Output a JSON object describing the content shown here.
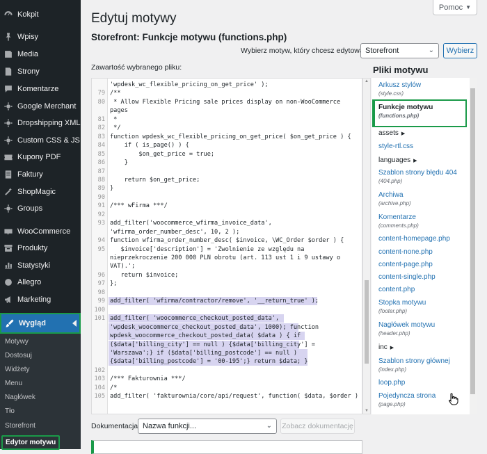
{
  "sidebar": {
    "items": [
      {
        "label": "Kokpit",
        "icon": "dashboard-icon",
        "name": "kokpit"
      },
      {
        "label": "Wpisy",
        "icon": "pushpin-icon",
        "name": "wpisy"
      },
      {
        "label": "Media",
        "icon": "media-icon",
        "name": "media"
      },
      {
        "label": "Strony",
        "icon": "page-icon",
        "name": "strony"
      },
      {
        "label": "Komentarze",
        "icon": "comment-icon",
        "name": "komentarze"
      },
      {
        "label": "Google Merchant",
        "icon": "gear-icon",
        "name": "google-merchant"
      },
      {
        "label": "Dropshipping XML",
        "icon": "gear-icon",
        "name": "dropshipping-xml"
      },
      {
        "label": "Custom CSS & JS",
        "icon": "gear-icon",
        "name": "custom-css-js"
      },
      {
        "label": "Kupony PDF",
        "icon": "ticket-icon",
        "name": "kupony-pdf"
      },
      {
        "label": "Faktury",
        "icon": "document-icon",
        "name": "faktury"
      },
      {
        "label": "ShopMagic",
        "icon": "magic-icon",
        "name": "shopmagic"
      },
      {
        "label": "Groups",
        "icon": "gear-icon",
        "name": "groups"
      },
      {
        "label": "WooCommerce",
        "icon": "woo-icon",
        "name": "woocommerce"
      },
      {
        "label": "Produkty",
        "icon": "archive-icon",
        "name": "produkty"
      },
      {
        "label": "Statystyki",
        "icon": "chart-icon",
        "name": "statystyki"
      },
      {
        "label": "Allegro",
        "icon": "allegro-icon",
        "name": "allegro"
      },
      {
        "label": "Marketing",
        "icon": "megaphone-icon",
        "name": "marketing"
      },
      {
        "label": "Wygląd",
        "icon": "brush-icon",
        "name": "wyglad"
      }
    ],
    "submenu": [
      "Motywy",
      "Dostosuj",
      "Widżety",
      "Menu",
      "Nagłówek",
      "Tło",
      "Storefront",
      "Edytor motywu"
    ]
  },
  "help_label": "Pomoc",
  "page_title": "Edytuj motywy",
  "file_heading": "Storefront: Funkcje motywu (functions.php)",
  "choose_theme_label": "Wybierz motyw, który chcesz edytować:",
  "theme_select_value": "Storefront",
  "choose_button": "Wybierz",
  "content_label": "Zawartość wybranego pliku:",
  "code_lines": [
    {
      "n": "",
      "t": "'wpdesk_wc_flexible_pricing_on_get_price' );"
    },
    {
      "n": "79",
      "t": "/**"
    },
    {
      "n": "80",
      "t": " * Allow Flexible Pricing sale prices display on non-WooCommerce"
    },
    {
      "n": "",
      "t": "pages"
    },
    {
      "n": "81",
      "t": " *"
    },
    {
      "n": "82",
      "t": " */"
    },
    {
      "n": "83",
      "t": "function wpdesk_wc_flexible_pricing_on_get_price( $on_get_price ) {"
    },
    {
      "n": "84",
      "t": "    if ( is_page() ) {"
    },
    {
      "n": "85",
      "t": "        $on_get_price = true;"
    },
    {
      "n": "86",
      "t": "    }"
    },
    {
      "n": "87",
      "t": ""
    },
    {
      "n": "88",
      "t": "    return $on_get_price;"
    },
    {
      "n": "89",
      "t": "}"
    },
    {
      "n": "90",
      "t": ""
    },
    {
      "n": "91",
      "t": "/*** wFirma ***/"
    },
    {
      "n": "92",
      "t": ""
    },
    {
      "n": "93",
      "t": "add_filter('woocommerce_wfirma_invoice_data',"
    },
    {
      "n": "",
      "t": "'wfirma_order_number_desc', 10, 2 );"
    },
    {
      "n": "94",
      "t": "function wfirma_order_number_desc( $invoice, \\WC_Order $order ) {"
    },
    {
      "n": "95",
      "t": "   $invoice['description'] = 'Zwolnienie ze względu na"
    },
    {
      "n": "",
      "t": "nieprzekroczenie 200 000 PLN obrotu (art. 113 ust 1 i 9 ustawy o"
    },
    {
      "n": "",
      "t": "VAT).';"
    },
    {
      "n": "96",
      "t": "   return $invoice;"
    },
    {
      "n": "97",
      "t": "};"
    },
    {
      "n": "98",
      "t": ""
    },
    {
      "n": "99",
      "t": "add_filter( 'wfirma/contractor/remove', '__return_true' );"
    },
    {
      "n": "100",
      "t": ""
    },
    {
      "n": "101",
      "t": "add_filter( 'woocommerce_checkout_posted_data',"
    },
    {
      "n": "",
      "t": "'wpdesk_woocommerce_checkout_posted_data', 1000); function"
    },
    {
      "n": "",
      "t": "wpdesk_woocommerce_checkout_posted_data( $data ) { if"
    },
    {
      "n": "",
      "t": "($data['billing_city'] == null ) {$data['billing_city'] ="
    },
    {
      "n": "",
      "t": "'Warszawa';} if ($data['billing_postcode'] == null )"
    },
    {
      "n": "",
      "t": "{$data['billing_postcode'] = '00-195';} return $data; }"
    },
    {
      "n": "102",
      "t": ""
    },
    {
      "n": "103",
      "t": "/*** Fakturownia ***/"
    },
    {
      "n": "104",
      "t": "/*"
    },
    {
      "n": "105",
      "t": "add_filter( 'fakturownia/core/api/request', function( $data, $order )"
    }
  ],
  "files_title": "Pliki motywu",
  "files": [
    {
      "label": "Arkusz stylów",
      "sub": "(style.css)",
      "type": "file"
    },
    {
      "label": "Funkcje motywu",
      "sub": "(functions.php)",
      "type": "active"
    },
    {
      "label": "assets",
      "sub": "",
      "type": "folder"
    },
    {
      "label": "style-rtl.css",
      "sub": "",
      "type": "file"
    },
    {
      "label": "languages",
      "sub": "",
      "type": "folder"
    },
    {
      "label": "Szablon strony błędu 404",
      "sub": "(404.php)",
      "type": "file"
    },
    {
      "label": "Archiwa",
      "sub": "(archive.php)",
      "type": "file"
    },
    {
      "label": "Komentarze",
      "sub": "(comments.php)",
      "type": "file"
    },
    {
      "label": "content-homepage.php",
      "sub": "",
      "type": "file"
    },
    {
      "label": "content-none.php",
      "sub": "",
      "type": "file"
    },
    {
      "label": "content-page.php",
      "sub": "",
      "type": "file"
    },
    {
      "label": "content-single.php",
      "sub": "",
      "type": "file"
    },
    {
      "label": "content.php",
      "sub": "",
      "type": "file"
    },
    {
      "label": "Stopka motywu",
      "sub": "(footer.php)",
      "type": "file"
    },
    {
      "label": "Nagłówek motywu",
      "sub": "(header.php)",
      "type": "file"
    },
    {
      "label": "inc",
      "sub": "",
      "type": "folder"
    },
    {
      "label": "Szablon strony głównej",
      "sub": "(index.php)",
      "type": "file"
    },
    {
      "label": "loop.php",
      "sub": "",
      "type": "file"
    },
    {
      "label": "Pojedyncza strona",
      "sub": "(page.php)",
      "type": "file"
    }
  ],
  "docs_label": "Dokumentacja:",
  "docs_select_value": "Nazwa funkcji...",
  "docs_button": "Zobacz dokumentację",
  "colors": {
    "accent": "#2271b1",
    "sidebar": "#1d2327",
    "highlight_box": "#1a9a49",
    "selection": "#d7d4f0"
  }
}
